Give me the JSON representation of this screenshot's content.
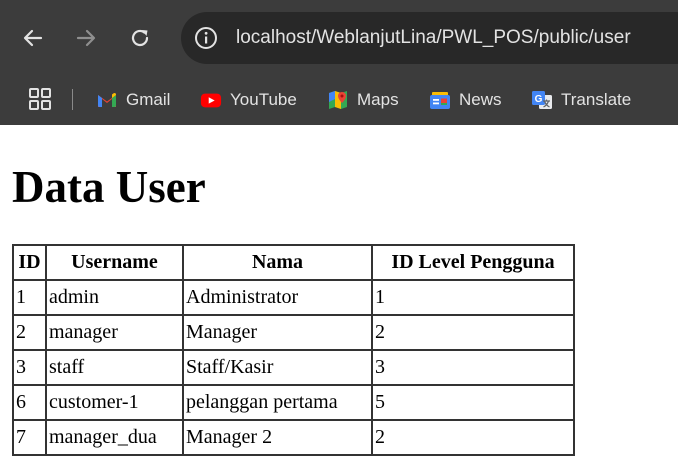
{
  "browser": {
    "url": "localhost/WeblanjutLina/PWL_POS/public/user",
    "bookmarks": [
      {
        "label": "Gmail",
        "icon": "gmail-icon"
      },
      {
        "label": "YouTube",
        "icon": "youtube-icon"
      },
      {
        "label": "Maps",
        "icon": "maps-icon"
      },
      {
        "label": "News",
        "icon": "news-icon"
      },
      {
        "label": "Translate",
        "icon": "translate-icon"
      }
    ]
  },
  "page": {
    "title": "Data User",
    "table": {
      "headers": [
        "ID",
        "Username",
        "Nama",
        "ID Level Pengguna"
      ],
      "rows": [
        [
          "1",
          "admin",
          "Administrator",
          "1"
        ],
        [
          "2",
          "manager",
          "Manager",
          "2"
        ],
        [
          "3",
          "staff",
          "Staff/Kasir",
          "3"
        ],
        [
          "6",
          "customer-1",
          "pelanggan pertama",
          "5"
        ],
        [
          "7",
          "manager_dua",
          "Manager 2",
          "2"
        ]
      ]
    }
  },
  "colors": {
    "chrome_bg": "#3c3c3c",
    "omnibox_bg": "#282828",
    "chrome_text": "#e3e3e3",
    "page_bg": "#ffffff",
    "table_border": "#333333"
  }
}
